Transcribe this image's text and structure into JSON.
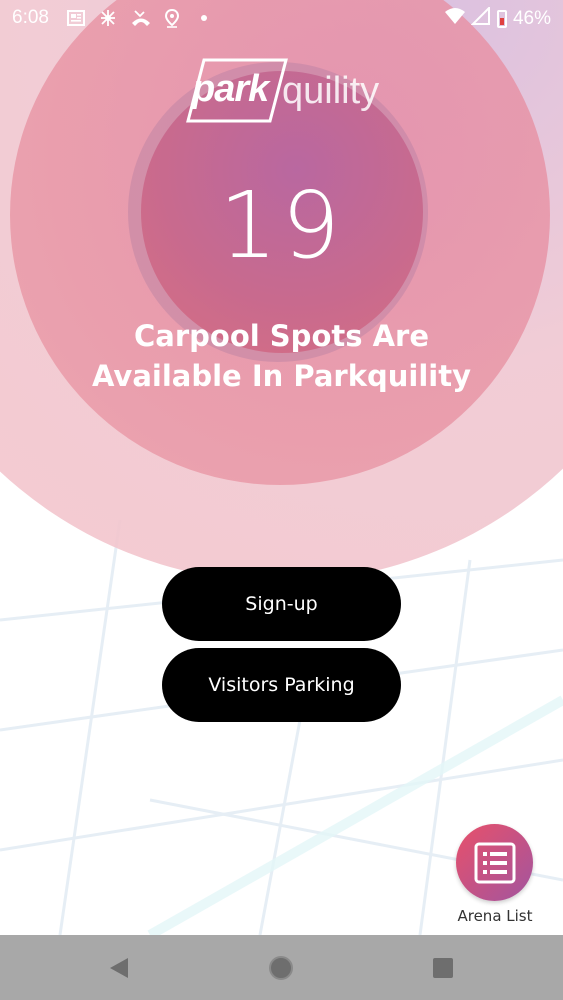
{
  "status_bar": {
    "time": "6:08",
    "battery": "46%",
    "icons": [
      "news-icon",
      "bug-icon",
      "missed-call-icon",
      "location-icon",
      "dot-icon",
      "wifi-icon",
      "signal-icon",
      "battery-icon"
    ]
  },
  "logo": {
    "bold": "park",
    "light": "quility"
  },
  "hero": {
    "count": "19",
    "line1": "Carpool Spots Are",
    "line2": "Available In Parkquility"
  },
  "buttons": {
    "signup_label": "Sign-up",
    "visitors_label": "Visitors Parking"
  },
  "fab": {
    "label": "Arena List"
  },
  "colors": {
    "accent_start": "#e8506a",
    "accent_end": "#a2559f",
    "button_bg": "#000000",
    "nav_bar": "#a8a8a8"
  }
}
